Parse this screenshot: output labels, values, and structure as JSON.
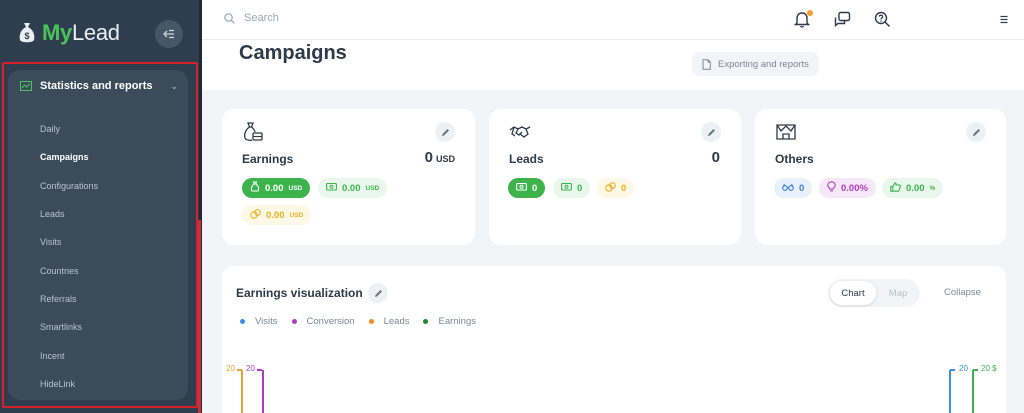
{
  "app": {
    "logo_my": "My",
    "logo_lead": "Lead",
    "brand_color": "#4cc25a"
  },
  "sidebar": {
    "section": {
      "label": "Statistics and reports",
      "icon": "chart-icon",
      "expanded": true
    },
    "items": [
      {
        "label": "Daily",
        "active": false
      },
      {
        "label": "Campaigns",
        "active": true
      },
      {
        "label": "Configurations",
        "active": false
      },
      {
        "label": "Leads",
        "active": false
      },
      {
        "label": "Visits",
        "active": false
      },
      {
        "label": "Countries",
        "active": false
      },
      {
        "label": "Referrals",
        "active": false
      },
      {
        "label": "Smartlinks",
        "active": false
      },
      {
        "label": "Incent",
        "active": false
      },
      {
        "label": "HideLink",
        "active": false
      }
    ]
  },
  "topbar": {
    "search_placeholder": "Search",
    "icons": [
      "bell-icon",
      "chat-icon",
      "support-icon",
      "menu-icon"
    ]
  },
  "header": {
    "title": "Campaigns",
    "export_label": "Exporting and reports"
  },
  "cards": {
    "earnings": {
      "title": "Earnings",
      "value": "0",
      "unit": "USD",
      "pills": [
        {
          "value": "0.00",
          "unit": "USD"
        },
        {
          "value": "0.00",
          "unit": "USD"
        },
        {
          "value": "0.00",
          "unit": "USD"
        }
      ]
    },
    "leads": {
      "title": "Leads",
      "value": "0",
      "pills": [
        {
          "value": "0"
        },
        {
          "value": "0"
        },
        {
          "value": "0"
        }
      ]
    },
    "others": {
      "title": "Others",
      "pills": [
        {
          "value": "0"
        },
        {
          "value": "0.00",
          "unit": "%"
        },
        {
          "value": "0.00",
          "unit": "%"
        }
      ]
    }
  },
  "chart_panel": {
    "title": "Earnings visualization",
    "tabs": {
      "chart": "Chart",
      "map": "Map",
      "selected": "Chart"
    },
    "collapse_label": "Collapse",
    "legend": [
      {
        "label": "Visits",
        "color": "#3a8ee6"
      },
      {
        "label": "Conversion",
        "color": "#b03cc0"
      },
      {
        "label": "Leads",
        "color": "#f08c20"
      },
      {
        "label": "Earnings",
        "color": "#1f8a2a"
      }
    ],
    "axes": {
      "left_1": {
        "label": "20",
        "color": "#f0a030"
      },
      "left_2": {
        "label": "20",
        "color": "#b03cc0"
      },
      "right_1": {
        "label": "20",
        "color": "#3a8ee6"
      },
      "right_2": {
        "label": "20 $",
        "color": "#3cb44b"
      }
    }
  }
}
